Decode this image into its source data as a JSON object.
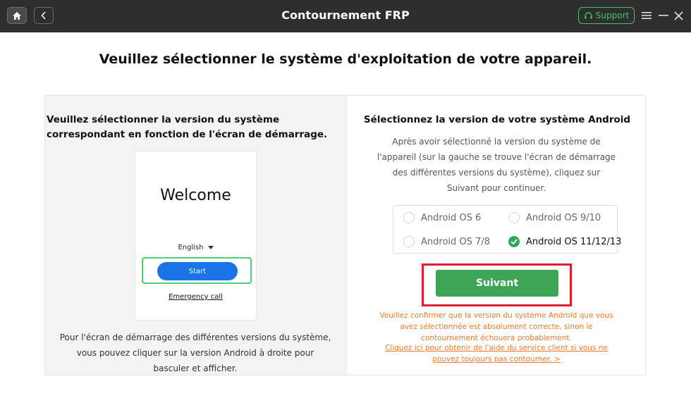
{
  "titlebar": {
    "title": "Contournement FRP",
    "support_label": "Support"
  },
  "page": {
    "heading": "Veuillez sélectionner le système d'exploitation de votre appareil."
  },
  "left_panel": {
    "heading": "Veuillez sélectionner la version du système correspondant en fonction de l'écran de démarrage.",
    "phone": {
      "welcome": "Welcome",
      "language": "English",
      "start_label": "Start",
      "emergency_label": "Emergency call"
    },
    "note": "Pour l'écran de démarrage des différentes versions du système, vous pouvez cliquer sur la version Android à droite pour basculer et afficher."
  },
  "right_panel": {
    "heading": "Sélectionnez la version de votre système Android",
    "description": "Après avoir sélectionné la version du système de l'appareil (sur la gauche se trouve l'écran de démarrage des différentes versions du système), cliquez sur Suivant pour continuer.",
    "os_options": [
      {
        "label": "Android OS 6",
        "selected": false
      },
      {
        "label": "Android OS 9/10",
        "selected": false
      },
      {
        "label": "Android OS 7/8",
        "selected": false
      },
      {
        "label": "Android OS 11/12/13",
        "selected": true
      }
    ],
    "next_label": "Suivant",
    "warning": "Veuillez confirmer que la version du système Android que vous avez sélectionnée est absolument correcte, sinon le contournement échouera probablement.",
    "help_link": "Cliquez ici pour obtenir de l'aide du service client si vous ne pouvez toujours pas contourner. >"
  },
  "colors": {
    "titlebar_bg": "#2e2e2e",
    "accent_green": "#3da556",
    "highlight_red": "#e01d2e",
    "warning_orange": "#f07a2a",
    "start_blue": "#1b73e8"
  },
  "icons": [
    "home-icon",
    "chevron-left-icon",
    "headset-icon",
    "hamburger-menu-icon",
    "minimize-icon",
    "close-icon",
    "dropdown-arrow-icon",
    "checkmark-icon"
  ]
}
